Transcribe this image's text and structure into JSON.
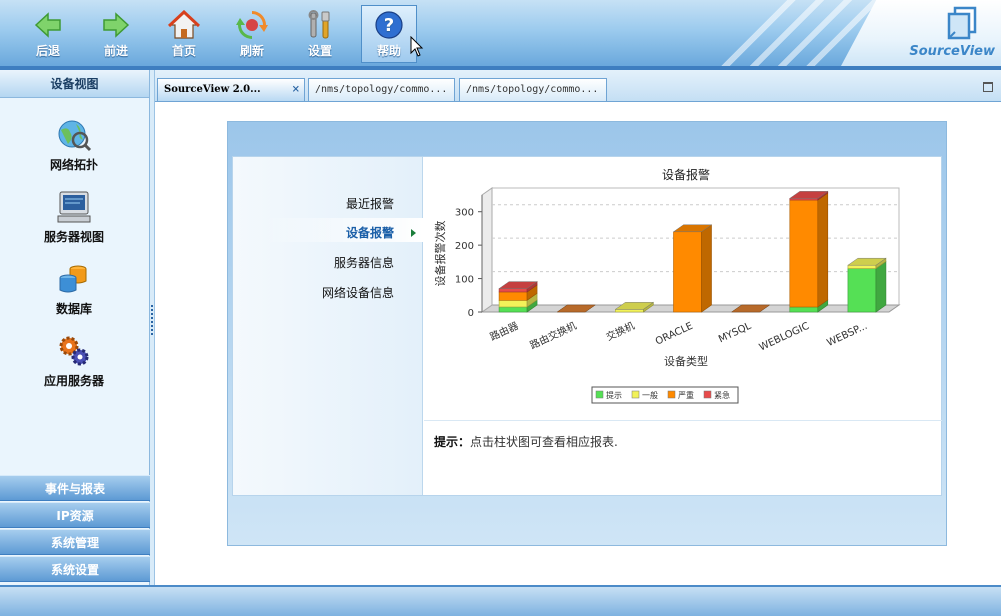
{
  "toolbar": {
    "buttons": [
      {
        "label": "后退",
        "icon": "back-arrow-icon"
      },
      {
        "label": "前进",
        "icon": "forward-arrow-icon"
      },
      {
        "label": "首页",
        "icon": "home-icon"
      },
      {
        "label": "刷新",
        "icon": "refresh-icon"
      },
      {
        "label": "设置",
        "icon": "settings-tools-icon"
      },
      {
        "label": "帮助",
        "icon": "help-icon"
      }
    ],
    "brand": "SourceView"
  },
  "sidebar": {
    "header": "设备视图",
    "items": [
      {
        "label": "网络拓扑",
        "icon": "globe-network-icon"
      },
      {
        "label": "服务器视图",
        "icon": "server-monitor-icon"
      },
      {
        "label": "数据库",
        "icon": "database-icon"
      },
      {
        "label": "应用服务器",
        "icon": "gears-icon"
      }
    ],
    "sections": [
      "事件与报表",
      "IP资源",
      "系统管理",
      "系统设置"
    ]
  },
  "tabs": [
    {
      "label": "SourceView 2.0...",
      "active": true
    },
    {
      "label": "/nms/topology/commo...",
      "active": false
    },
    {
      "label": "/nms/topology/commo...",
      "active": false
    }
  ],
  "menu": {
    "items": [
      "最近报警",
      "设备报警",
      "服务器信息",
      "网络设备信息"
    ],
    "active": "设备报警"
  },
  "hint": {
    "label": "提示：",
    "text": "点击柱状图可查看相应报表."
  },
  "chart_data": {
    "type": "bar",
    "title": "设备报警",
    "xlabel": "设备类型",
    "ylabel": "设备报警次数",
    "ylim": [
      0,
      350
    ],
    "yticks": [
      0,
      100,
      200,
      300
    ],
    "grid": true,
    "stacked": true,
    "categories": [
      "路由器",
      "路由交换机",
      "交换机",
      "ORACLE",
      "MYSQL",
      "WEBLOGIC",
      "WEBSP..."
    ],
    "series": [
      {
        "name": "提示",
        "color": "#55e055",
        "values": [
          15,
          0,
          0,
          0,
          0,
          15,
          130
        ]
      },
      {
        "name": "一般",
        "color": "#f2f25a",
        "values": [
          20,
          0,
          8,
          0,
          0,
          0,
          10
        ]
      },
      {
        "name": "严重",
        "color": "#ff8a00",
        "values": [
          25,
          0,
          0,
          240,
          0,
          320,
          0
        ]
      },
      {
        "name": "紧急",
        "color": "#e84b4b",
        "values": [
          10,
          0,
          0,
          0,
          0,
          5,
          0
        ]
      }
    ],
    "legend": "bottom"
  }
}
